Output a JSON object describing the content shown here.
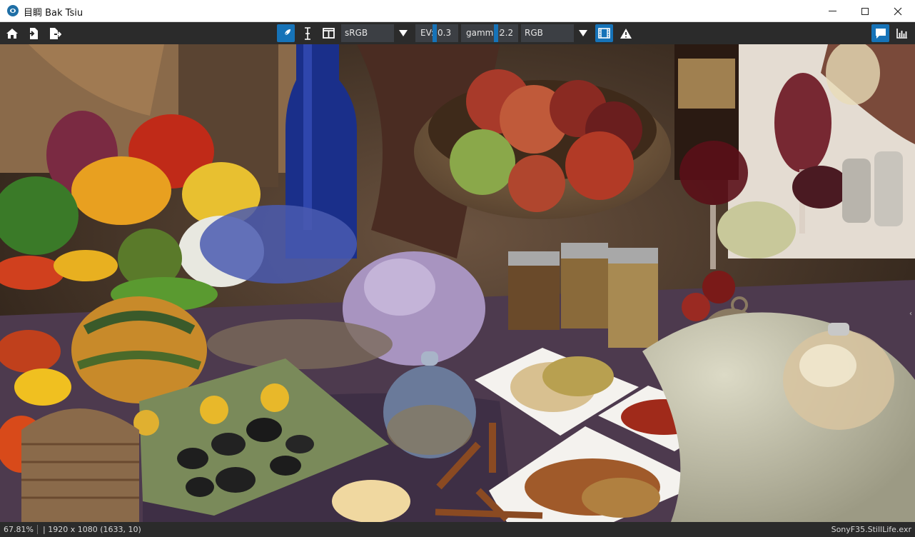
{
  "window": {
    "title": "目睭 Bak Tsiu",
    "controls": {
      "minimize": "minimize",
      "maximize": "maximize",
      "close": "close"
    }
  },
  "toolbar": {
    "left_icons": [
      "home-icon",
      "open-file-icon",
      "export-file-icon"
    ],
    "tool_icons": [
      "color-picker-icon",
      "text-cursor-icon",
      "split-view-icon"
    ],
    "colorspace": {
      "value": "sRGB"
    },
    "exposure": {
      "label": "EV:",
      "value": "0.3"
    },
    "gamma": {
      "label": "gamma:",
      "value": "2.2"
    },
    "channel": {
      "value": "RGB"
    },
    "right_icons": [
      "film-icon",
      "warning-icon"
    ],
    "far_right_icons": [
      "comment-icon",
      "histogram-icon"
    ],
    "accent": "#1673b8"
  },
  "status": {
    "zoom": "67.81%",
    "info": "| 1920 x 1080  (1633, 10)",
    "filename": "SonyF35.StillLife.exr"
  }
}
